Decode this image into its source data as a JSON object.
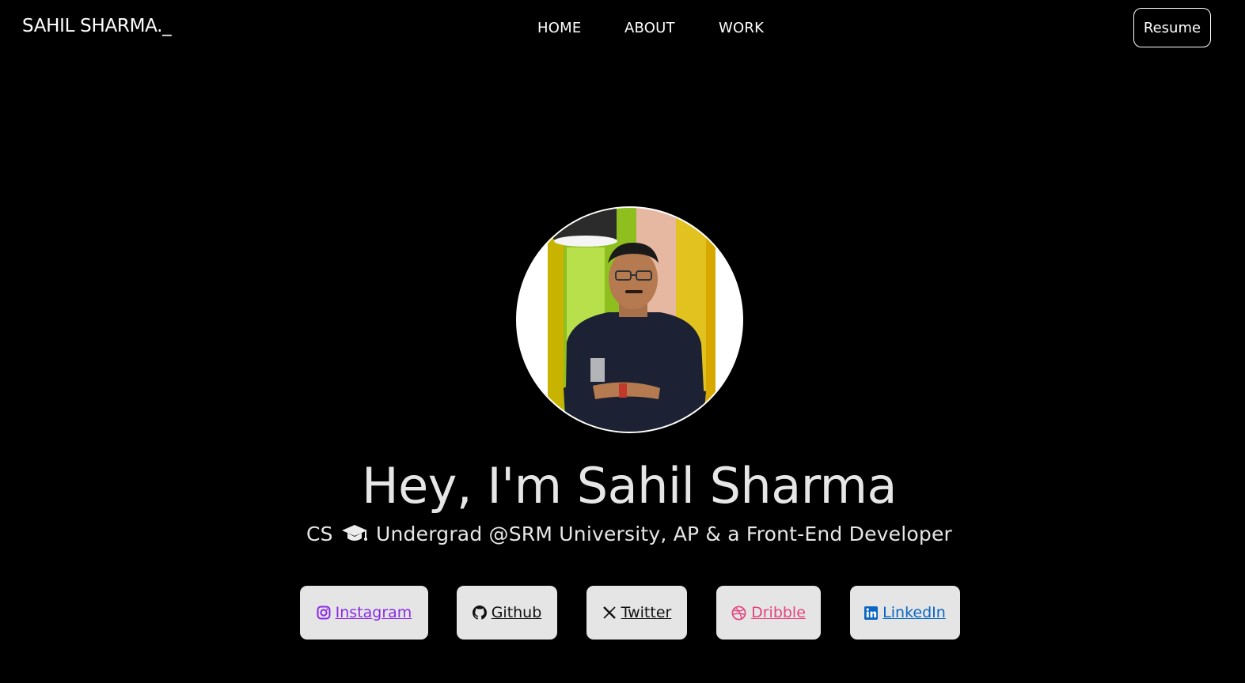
{
  "header": {
    "brand": "SAHIL SHARMA._",
    "nav": [
      {
        "label": "HOME"
      },
      {
        "label": "ABOUT"
      },
      {
        "label": "WORK"
      }
    ],
    "resume_label": "Resume"
  },
  "hero": {
    "title": "Hey, I'm Sahil Sharma",
    "subtitle_prefix": "CS",
    "subtitle_icon": "graduation-cap-icon",
    "subtitle_rest": "Undergrad @SRM University, AP & a Front-End Developer"
  },
  "social": [
    {
      "label": "Instagram",
      "icon": "instagram-icon",
      "color": "#8a2be2"
    },
    {
      "label": "Github",
      "icon": "github-icon",
      "color": "#111111"
    },
    {
      "label": "Twitter",
      "icon": "x-icon",
      "color": "#111111"
    },
    {
      "label": "Dribble",
      "icon": "dribbble-icon",
      "color": "#e4447f"
    },
    {
      "label": "LinkedIn",
      "icon": "linkedin-icon",
      "color": "#0a66c2"
    }
  ],
  "colors": {
    "background": "#000000",
    "button_bg": "#e5e5e5",
    "text": "#ffffff"
  }
}
